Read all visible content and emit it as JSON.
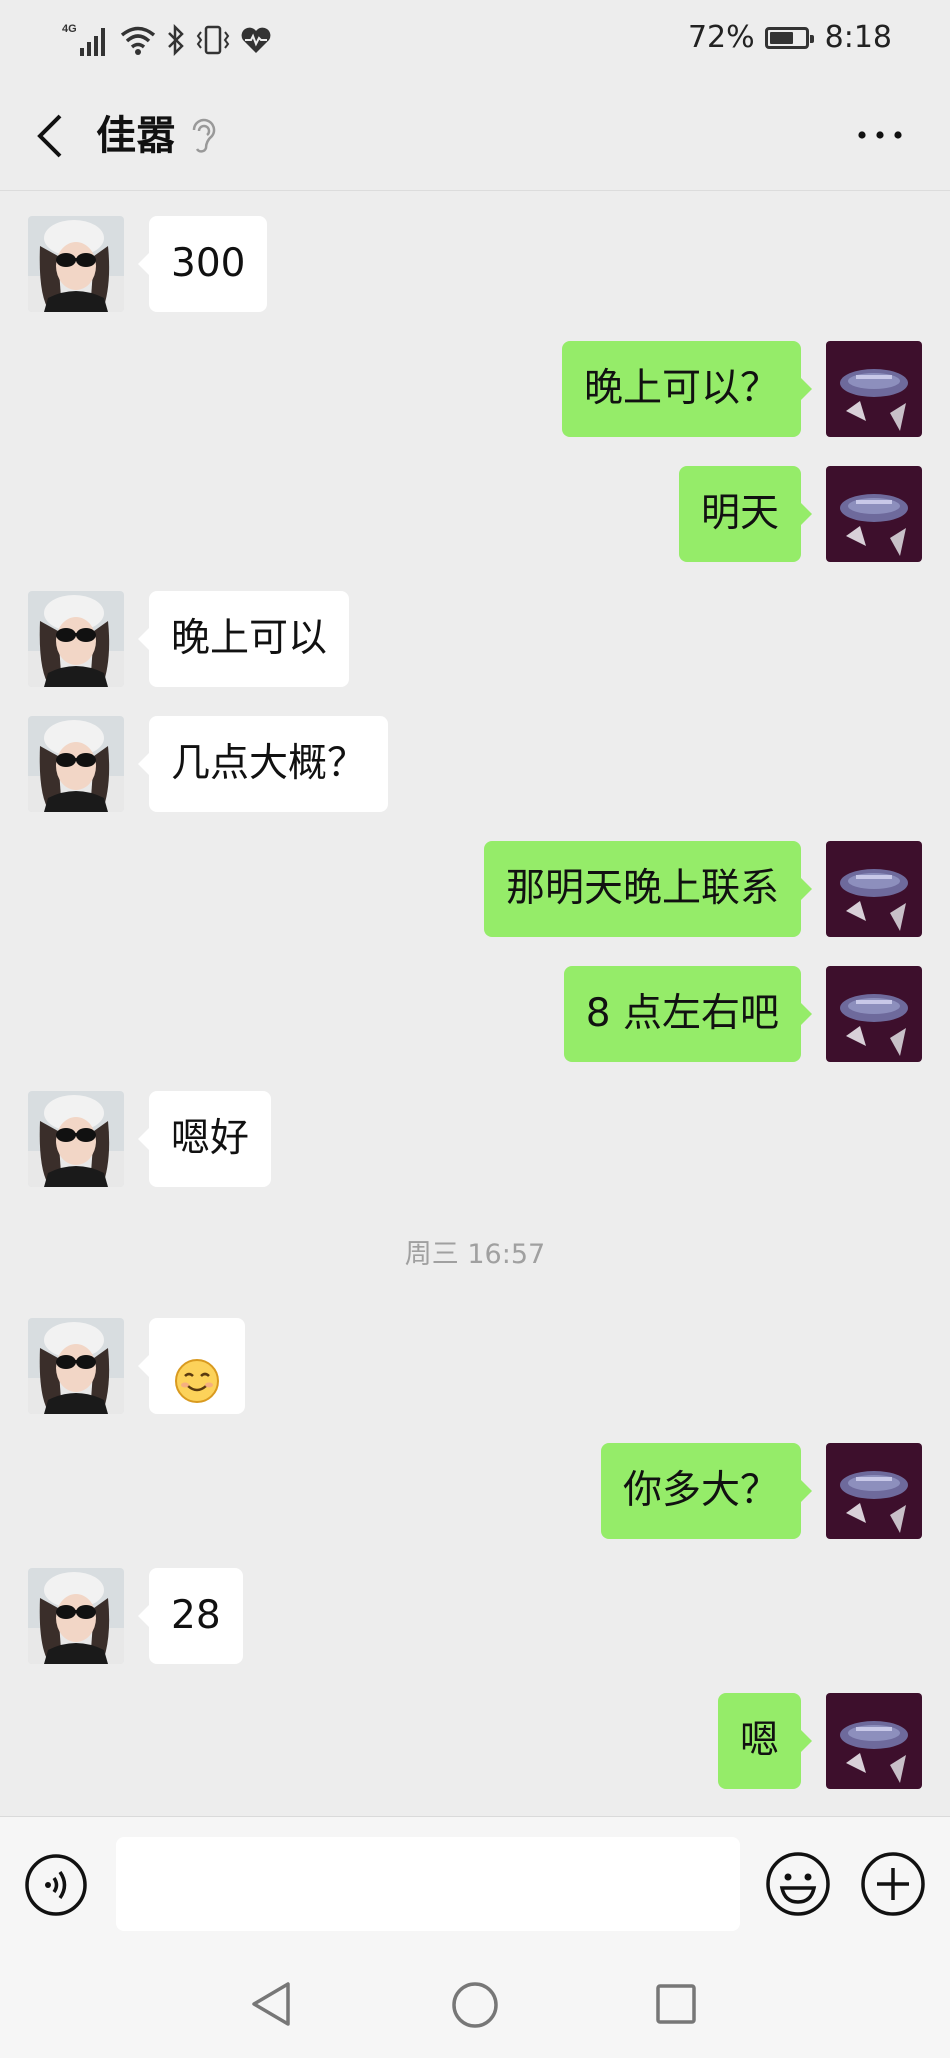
{
  "status_bar": {
    "network": "4G",
    "battery": "72%",
    "battery_level": 0.72,
    "time": "8:18"
  },
  "header": {
    "title": "佳嚣"
  },
  "messages": [
    {
      "side": "left",
      "text": "300"
    },
    {
      "side": "right",
      "text": "晚上可以？"
    },
    {
      "side": "right",
      "text": "明天"
    },
    {
      "side": "left",
      "text": "晚上可以"
    },
    {
      "side": "left",
      "text": "几点大概？"
    },
    {
      "side": "right",
      "text": "那明天晚上联系"
    },
    {
      "side": "right",
      "text": "8 点左右吧"
    },
    {
      "side": "left",
      "text": "嗯好"
    },
    {
      "side": "left",
      "emoji": "smile-emoji"
    },
    {
      "side": "right",
      "text": "你多大？"
    },
    {
      "side": "left",
      "text": "28"
    },
    {
      "side": "right",
      "text": "嗯"
    }
  ],
  "timestamp": "周三 16:57",
  "input": {
    "value": ""
  },
  "colors": {
    "background": "#ededed",
    "outgoing_bubble": "#95ec69",
    "incoming_bubble": "#ffffff",
    "timestamp": "#a0a0a0"
  },
  "icons": {
    "back": "chevron-left-icon",
    "ear": "ear-icon",
    "more": "more-dots-icon",
    "voice": "voice-icon",
    "emoji": "emoji-icon",
    "plus": "plus-icon",
    "nav_back": "triangle-back-icon",
    "nav_home": "circle-home-icon",
    "nav_recent": "square-recent-icon"
  }
}
